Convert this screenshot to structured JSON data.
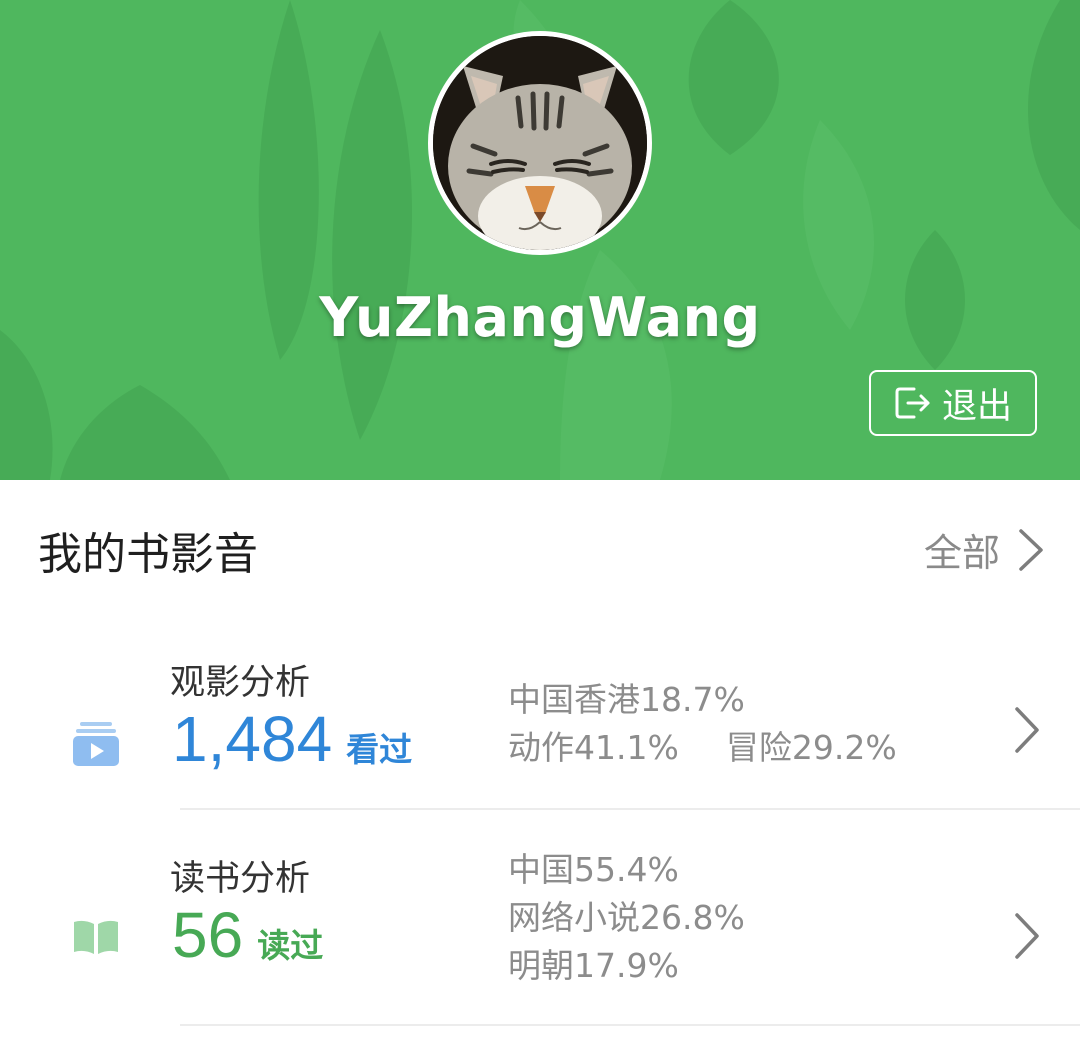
{
  "profile": {
    "username": "YuZhangWang",
    "logout_label": "退出"
  },
  "section": {
    "title": "我的书影音",
    "all_label": "全部"
  },
  "movies": {
    "title": "观影分析",
    "count": "1,484",
    "unit": "看过",
    "stats": [
      "中国香港18.7%",
      "动作41.1%",
      "冒险29.2%"
    ],
    "accent": "#2f86d8"
  },
  "books": {
    "title": "读书分析",
    "count": "56",
    "unit": "读过",
    "stats": [
      "中国55.4%",
      "网络小说26.8%",
      "明朝17.9%"
    ],
    "accent": "#47a955"
  },
  "colors": {
    "header_green": "#4fb75e"
  }
}
